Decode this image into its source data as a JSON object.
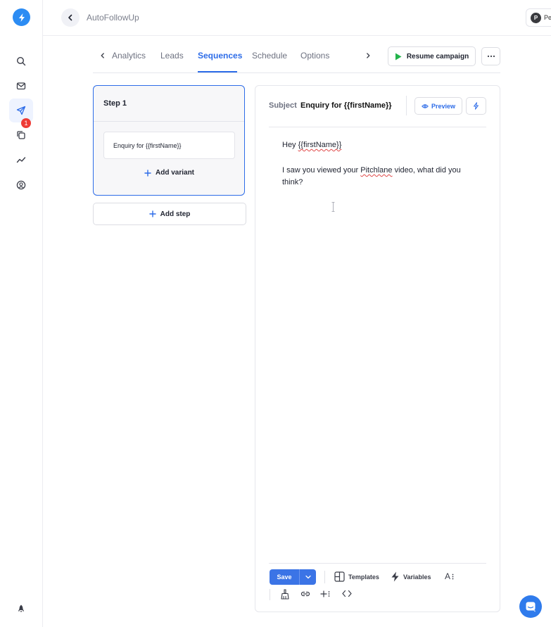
{
  "header": {
    "app_title": "AutoFollowUp",
    "user_initial": "P",
    "user_name": "Pe"
  },
  "nav": {
    "notification_count": "1",
    "items": [
      "search-icon",
      "mail-icon",
      "send-icon",
      "copy-icon",
      "analytics-icon",
      "account-icon",
      "rocket-icon"
    ]
  },
  "tabs": {
    "items": [
      {
        "label": "Analytics"
      },
      {
        "label": "Leads"
      },
      {
        "label": "Sequences"
      },
      {
        "label": "Schedule"
      },
      {
        "label": "Options"
      }
    ],
    "active": "Sequences",
    "resume_label": "Resume campaign"
  },
  "steps": {
    "step_title": "Step 1",
    "variant_subject": "Enquiry for {{firstName}}",
    "add_variant_label": "Add variant",
    "add_step_label": "Add step"
  },
  "editor": {
    "subject_label": "Subject",
    "subject_value": "Enquiry for {{firstName}}",
    "preview_label": "Preview",
    "body": {
      "greeting_prefix": "Hey ",
      "greeting_var": "{{firstName}}",
      "line2_prefix": "I saw you viewed your ",
      "line2_brand": "Pitchlane",
      "line2_suffix": " video, what did you think?"
    },
    "toolbar": {
      "save_label": "Save",
      "templates_label": "Templates",
      "variables_label": "Variables",
      "font_label": "A"
    }
  },
  "colors": {
    "accent": "#2d6ce8",
    "logo": "#2c8cf3",
    "badge": "#ee3b35",
    "save": "#3b74e6",
    "resume_play": "#22b34a"
  }
}
